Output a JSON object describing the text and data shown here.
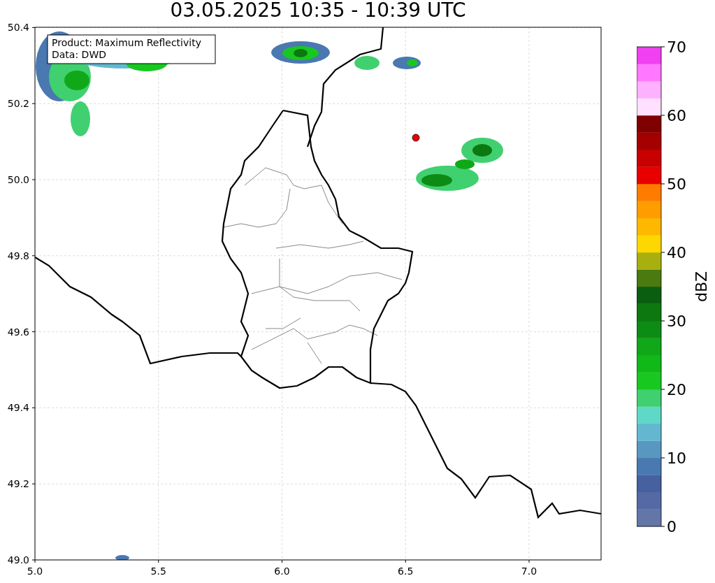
{
  "title": "03.05.2025 10:35 - 10:39 UTC",
  "legend": {
    "lines": [
      "Product: Maximum Reflectivity",
      "Data: DWD"
    ]
  },
  "map": {
    "x_ticks": [
      "5.0",
      "5.5",
      "6.0",
      "6.5",
      "7.0"
    ],
    "y_ticks": [
      "50.4",
      "50.2",
      "50.0",
      "49.8",
      "49.6",
      "49.4",
      "49.2",
      "49.0"
    ]
  },
  "colorbar": {
    "label": "dBZ",
    "ticks": [
      "70",
      "60",
      "50",
      "40",
      "30",
      "20",
      "10",
      "0"
    ],
    "bins": [
      {
        "color": "#6476a8"
      },
      {
        "color": "#556aa5"
      },
      {
        "color": "#4660a0"
      },
      {
        "color": "#4a78b0"
      },
      {
        "color": "#5898c0"
      },
      {
        "color": "#63b8d0"
      },
      {
        "color": "#60d8c8"
      },
      {
        "color": "#40d070"
      },
      {
        "color": "#18c820"
      },
      {
        "color": "#10b818"
      },
      {
        "color": "#10a818"
      },
      {
        "color": "#0c8c14"
      },
      {
        "color": "#0c7810"
      },
      {
        "color": "#0a5e10"
      },
      {
        "color": "#4a7a10"
      },
      {
        "color": "#a8b010"
      },
      {
        "color": "#ffd700"
      },
      {
        "color": "#ffb800"
      },
      {
        "color": "#ff9c00"
      },
      {
        "color": "#ff7c00"
      },
      {
        "color": "#e80000"
      },
      {
        "color": "#c80000"
      },
      {
        "color": "#a40000"
      },
      {
        "color": "#800000"
      },
      {
        "color": "#ffe0ff"
      },
      {
        "color": "#ffb0ff"
      },
      {
        "color": "#ff78ff"
      },
      {
        "color": "#f040f0"
      }
    ]
  }
}
